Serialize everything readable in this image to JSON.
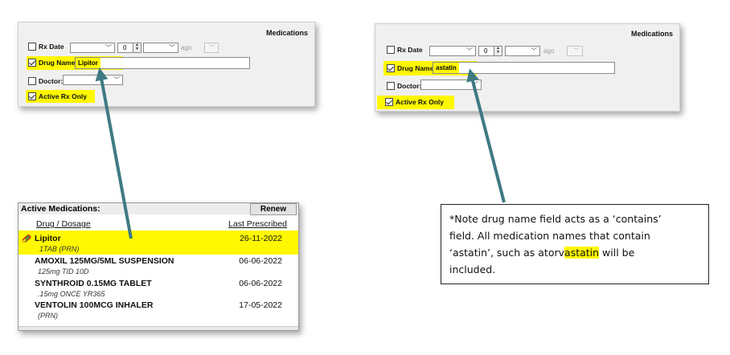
{
  "panel_left": {
    "title": "Medications",
    "rx_date_label": "Rx Date",
    "rx_date_number": "0",
    "ago": "ago",
    "drug_name_label": "Drug Name:",
    "drug_name_value": "Lipitor",
    "doctor_label": "Doctor:",
    "active_rx_label": "Active Rx Only"
  },
  "panel_right": {
    "title": "Medications",
    "rx_date_label": "Rx Date",
    "rx_date_number": "0",
    "ago": "ago",
    "drug_name_label": "Drug Name:",
    "drug_name_value": "astatin",
    "doctor_label": "Doctor:",
    "active_rx_label": "Active Rx Only"
  },
  "active_meds": {
    "title": "Active Medications:",
    "renew_label": "Renew",
    "col_drug": "Drug / Dosage",
    "col_last": "Last Prescribed",
    "rows": [
      {
        "name": "Lipitor",
        "dose": "1TAB  (PRN)",
        "date": "26-11-2022",
        "highlighted": true
      },
      {
        "name": "AMOXIL 125MG/5ML SUSPENSION",
        "dose": "125mg TID 10D",
        "date": "06-06-2022",
        "highlighted": false
      },
      {
        "name": "SYNTHROID 0.15MG TABLET",
        "dose": ".15mg ONCE YR365",
        "date": "06-06-2022",
        "highlighted": false
      },
      {
        "name": "VENTOLIN 100MCG INHALER",
        "dose": "(PRN)",
        "date": "17-05-2022",
        "highlighted": false
      }
    ]
  },
  "note": {
    "line1": "*Note drug name field acts as a ‘contains’",
    "line2": "field. All medication names that contain",
    "line3_pre": "‘astatin’, such as atorv",
    "line3_mark": "astatin",
    "line3_post": " will be",
    "line4": "included."
  },
  "colors": {
    "highlight": "#fff800",
    "arrow": "#3f7a83",
    "panel_bg": "#f0f0f0"
  }
}
